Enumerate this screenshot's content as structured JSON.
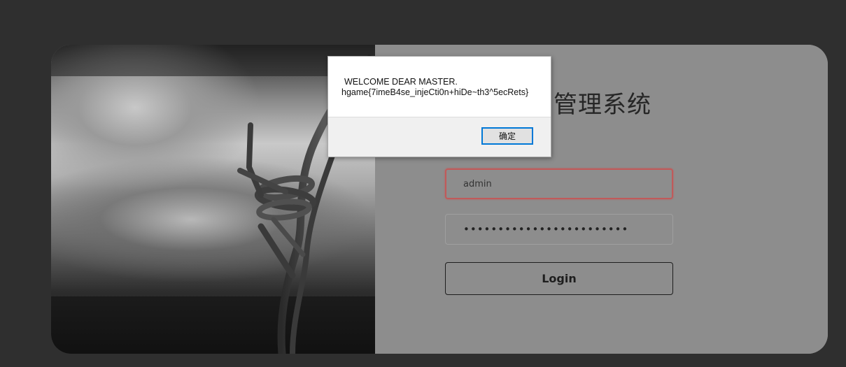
{
  "page": {
    "background_color": "#2f2f2f",
    "panel_color": "#8d8d8d"
  },
  "login": {
    "title": "管理系统",
    "username_value": "admin",
    "password_value": "••••••••••••••••••••••••",
    "login_label": "Login"
  },
  "alert": {
    "line1": "WELCOME DEAR MASTER.",
    "line2": "hgame{7imeB4se_injeCti0n+hiDe~th3^5ecRets}",
    "ok_label": "确定",
    "accent_color": "#0078d7"
  }
}
